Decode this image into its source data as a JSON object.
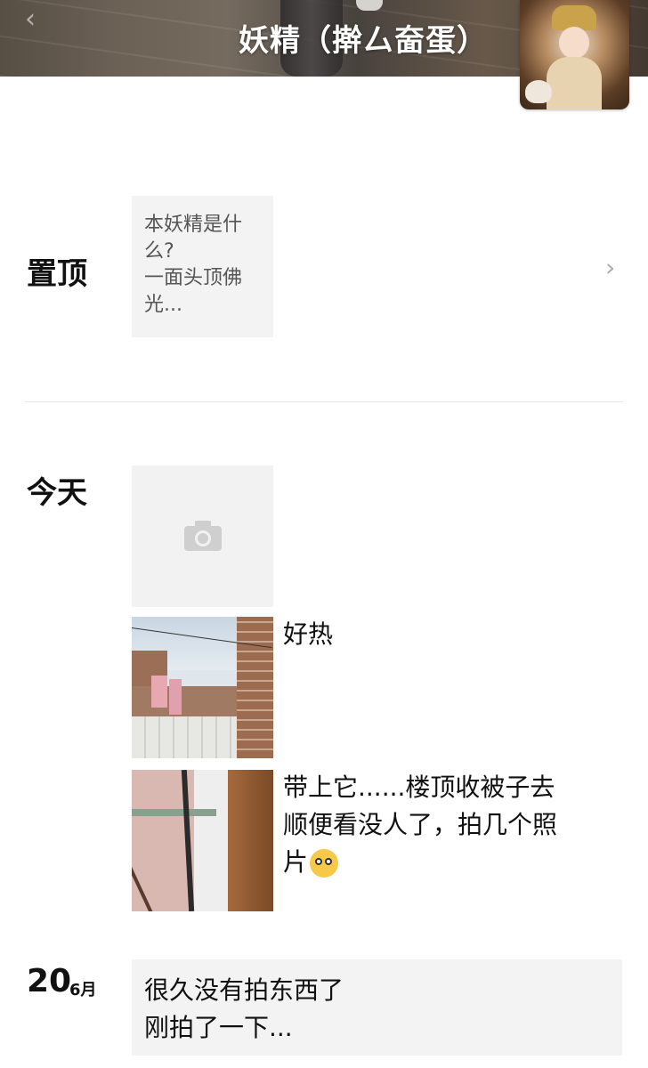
{
  "header": {
    "title": "妖精（擀厶奤蛋）",
    "back_icon": "chevron-left-icon",
    "avatar": "profile-avatar"
  },
  "pinned": {
    "label": "置顶",
    "preview_lines": [
      "本妖精是什",
      "么?",
      "一面头顶佛",
      "光..."
    ],
    "chevron_icon": "chevron-right-icon"
  },
  "today": {
    "label": "今天",
    "posts": [
      {
        "type": "photo-placeholder",
        "icon": "camera-icon"
      },
      {
        "type": "photo",
        "text": "好热"
      },
      {
        "type": "photo",
        "lines": [
          "带上它......楼顶收被子去",
          "顺便看没人了，拍几个照",
          "片"
        ],
        "emoji": "dizzy-face-emoji"
      }
    ]
  },
  "earlier": {
    "day": "20",
    "month": "6月",
    "lines": [
      "很久没有拍东西了",
      "刚拍了一下..."
    ]
  }
}
